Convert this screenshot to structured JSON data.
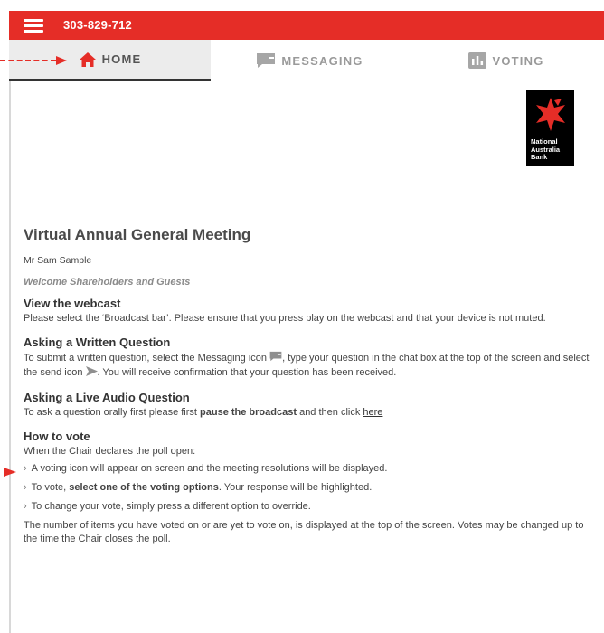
{
  "header": {
    "meeting_id": "303-829-712",
    "accent_color": "#e52d27",
    "menu_icon": "hamburger-icon"
  },
  "tabs": [
    {
      "label": "HOME",
      "icon": "home-icon",
      "active": true
    },
    {
      "label": "MESSAGING",
      "icon": "chat-icon",
      "active": false
    },
    {
      "label": "VOTING",
      "icon": "bar-chart-icon",
      "active": false
    }
  ],
  "logo": {
    "line1": "National",
    "line2": "Australia",
    "line3": "Bank",
    "icon": "star-icon"
  },
  "page": {
    "title": "Virtual Annual General Meeting",
    "user": "Mr Sam Sample",
    "welcome": "Welcome Shareholders and Guests"
  },
  "webcast": {
    "heading": "View the webcast",
    "text": "Please select the ‘Broadcast bar’. Please ensure that you press play on the webcast and that your device is not muted."
  },
  "written_question": {
    "heading": "Asking a Written Question",
    "text1": "To submit a written question, select the Messaging icon ",
    "text2": ", type your question in the chat box at the top of the screen and select the send icon ",
    "text3": ". You will receive confirmation that your question has been received."
  },
  "audio_question": {
    "heading": "Asking a Live Audio Question",
    "text1": "To ask a question orally first please first ",
    "bold": "pause the broadcast",
    "text2": " and then click ",
    "link": "here"
  },
  "vote": {
    "heading": "How to vote",
    "intro": "When the Chair declares the poll open:",
    "bullet_marker": "›",
    "b1": "A voting icon will appear on screen and the meeting resolutions will be displayed.",
    "b2_pre": "To vote, ",
    "b2_bold": "select one of the voting options",
    "b2_post": ". Your response will be highlighted.",
    "b3": "To change your vote, simply press a different option to override.",
    "note": "The number of items you have voted on or are yet to vote on, is displayed at the top of the screen. Votes may be changed up to the time the Chair closes the poll."
  }
}
